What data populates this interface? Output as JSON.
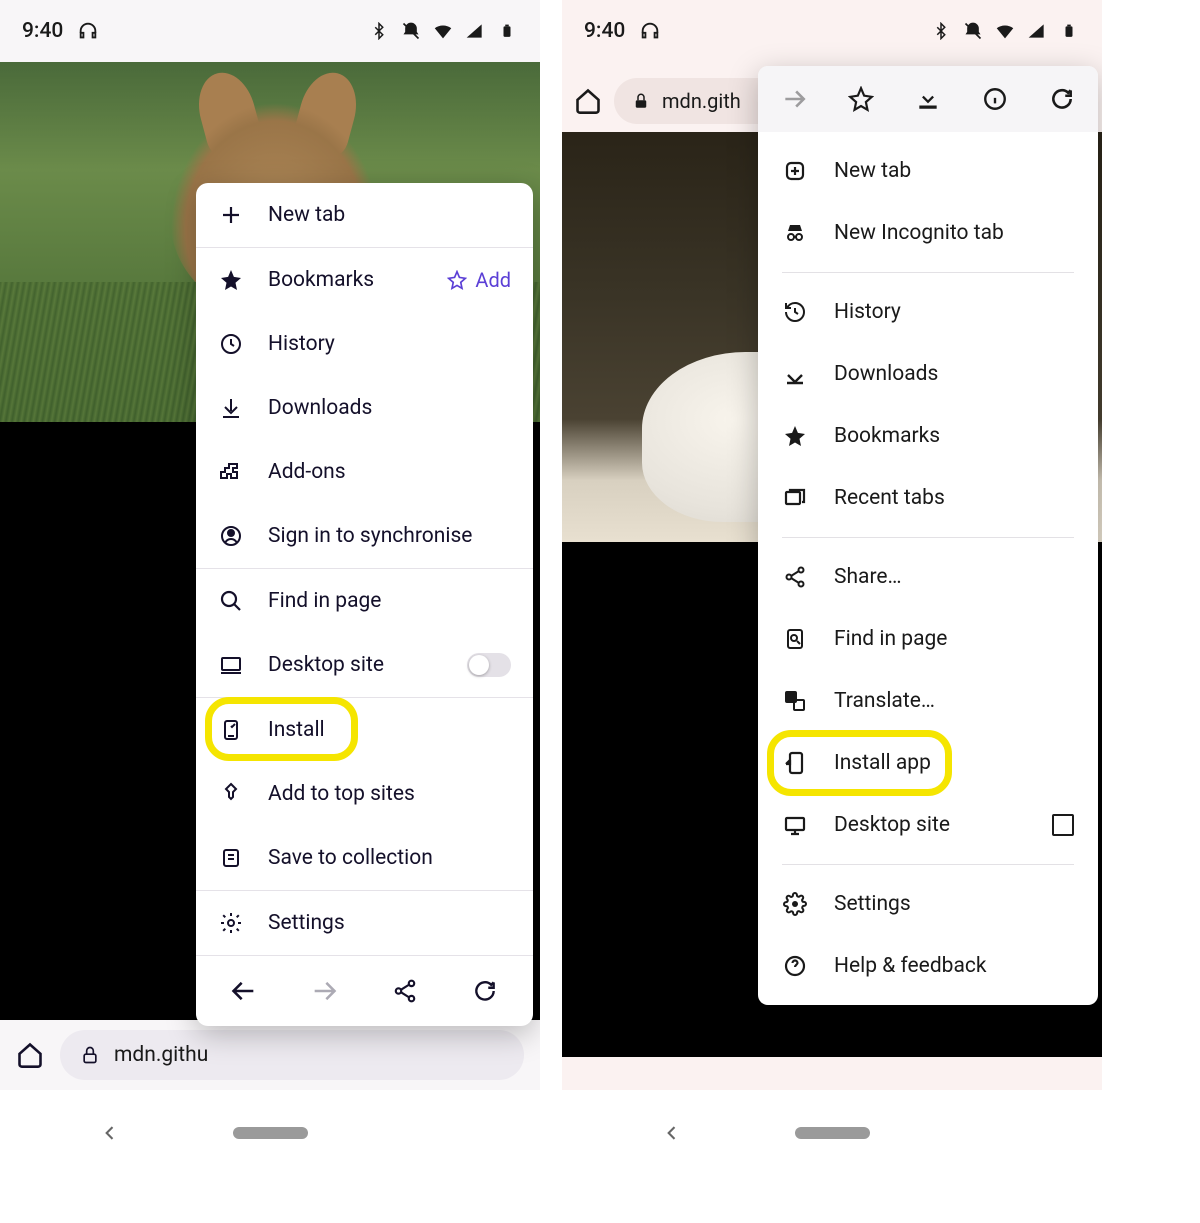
{
  "statusbar": {
    "time": "9:40"
  },
  "left": {
    "url_display": "mdn.githu",
    "menu": {
      "new_tab": "New tab",
      "bookmarks": "Bookmarks",
      "bookmarks_add": "Add",
      "history": "History",
      "downloads": "Downloads",
      "addons": "Add-ons",
      "sign_in": "Sign in to synchronise",
      "find_in_page": "Find in page",
      "desktop_site": "Desktop site",
      "install": "Install",
      "add_top_sites": "Add to top sites",
      "save_collection": "Save to collection",
      "settings": "Settings"
    }
  },
  "right": {
    "url_display": "mdn.gith",
    "menu": {
      "new_tab": "New tab",
      "incognito": "New Incognito tab",
      "history": "History",
      "downloads": "Downloads",
      "bookmarks": "Bookmarks",
      "recent_tabs": "Recent tabs",
      "share": "Share…",
      "find_in_page": "Find in page",
      "translate": "Translate…",
      "install_app": "Install app",
      "desktop_site": "Desktop site",
      "settings": "Settings",
      "help": "Help & feedback"
    }
  }
}
